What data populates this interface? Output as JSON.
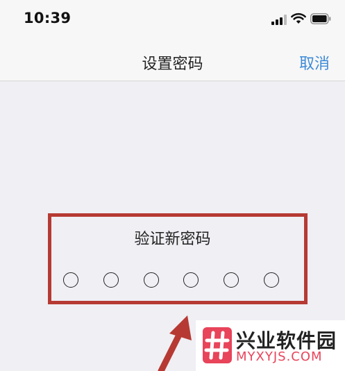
{
  "status_bar": {
    "time": "10:39",
    "signal_icon": "cellular-signal-icon",
    "wifi_icon": "wifi-icon",
    "battery_icon": "battery-icon"
  },
  "nav_bar": {
    "title": "设置密码",
    "cancel_label": "取消",
    "cancel_color": "#3d8ad7"
  },
  "passcode": {
    "prompt": "验证新密码",
    "digits_total": 6,
    "digits_entered": 0
  },
  "annotation": {
    "highlight_color": "#b63a33",
    "arrow_icon": "red-arrow-icon"
  },
  "watermark": {
    "name": "兴业软件园",
    "url": "MYXYJS.COM",
    "logo_icon": "hash-logo-icon",
    "brand_color": "#e8445a"
  }
}
